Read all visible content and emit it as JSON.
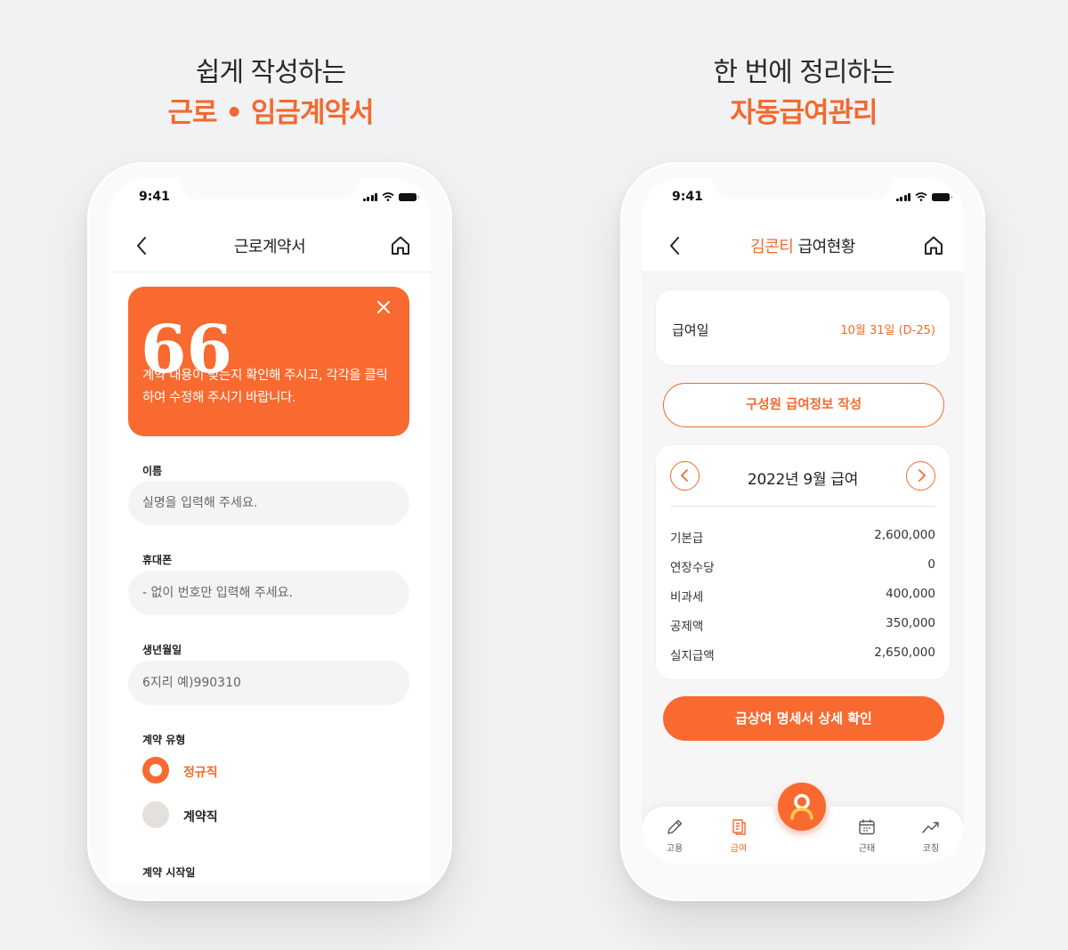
{
  "left_headline": {
    "line1": "쉽게 작성하는",
    "line2": "근로 • 임금계약서"
  },
  "right_headline": {
    "line1": "한 번에 정리하는",
    "line2": "자동급여관리"
  },
  "left_phone": {
    "status_time": "9:41",
    "nav_title": "근로계약서",
    "notice": {
      "quote_mark": "66",
      "message": "계약 내용이 맞는지 확인해 주시고, 각각을 클릭하여 수정해 주시기 바랍니다."
    },
    "fields": {
      "name_label": "이름",
      "name_placeholder": "실명을 입력해 주세요.",
      "phone_label": "휴대폰",
      "phone_placeholder": "- 없이 번호만 입력해 주세요.",
      "birth_label": "생년월일",
      "birth_placeholder": "6지리 예)990310",
      "type_label": "계약 유형",
      "type_options": [
        "정규직",
        "계약직"
      ],
      "type_selected": "정규직",
      "start_label": "계약 시작일"
    }
  },
  "right_phone": {
    "status_time": "9:41",
    "nav_title_name": "김콘티",
    "nav_title_rest": " 급여현황",
    "payday_label": "급여일",
    "payday_value": "10월 31일 (D-25)",
    "write_button": "구성원 급여정보 작성",
    "month_title": "2022년 9월 급여",
    "rows": [
      {
        "label": "기본급",
        "value": "2,600,000"
      },
      {
        "label": "연장수당",
        "value": "0"
      },
      {
        "label": "비과세",
        "value": "400,000"
      },
      {
        "label": "공제액",
        "value": "350,000"
      },
      {
        "label": "실지급액",
        "value": "2,650,000"
      }
    ],
    "detail_button": "급상여 명세서 상세 확인",
    "tabs": [
      {
        "label": "고용",
        "icon": "pencil-icon"
      },
      {
        "label": "급여",
        "icon": "payslip-icon",
        "active": true
      },
      {
        "label": "근태",
        "icon": "calendar-icon"
      },
      {
        "label": "코칭",
        "icon": "trend-icon"
      }
    ],
    "accent_color": "#f26a2e"
  }
}
